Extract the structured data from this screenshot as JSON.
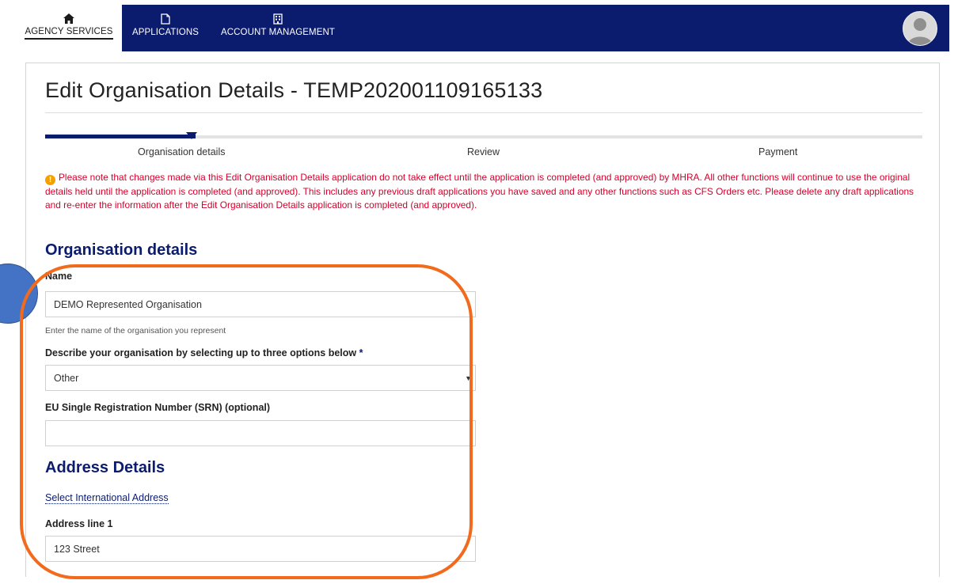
{
  "nav": {
    "items": [
      {
        "label": "AGENCY SERVICES",
        "icon": "home-icon",
        "active": true
      },
      {
        "label": "APPLICATIONS",
        "icon": "document-icon",
        "active": false
      },
      {
        "label": "ACCOUNT MANAGEMENT",
        "icon": "building-icon",
        "active": false
      }
    ],
    "avatar_icon": "user-avatar-icon"
  },
  "page": {
    "title": "Edit Organisation Details - TEMP202001109165133"
  },
  "steps": [
    "Organisation details",
    "Review",
    "Payment"
  ],
  "notice": {
    "icon": "warning-icon",
    "text": "Please note that changes made via this Edit Organisation Details application do not take effect until the application is completed (and approved) by MHRA. All other functions will continue to use the original details held until the application is completed (and approved). This includes any previous draft applications you have saved and any other functions such as CFS Orders etc. Please delete any draft applications and re-enter the information after the Edit Organisation Details application is completed (and approved)."
  },
  "form": {
    "section_title": "Organisation details",
    "name_label": "Name",
    "name_value": "DEMO Represented Organisation",
    "name_hint": "Enter the name of the organisation you represent",
    "describe_label": "Describe your organisation by selecting up to three options below",
    "required_marker": "*",
    "describe_value": "Other",
    "srn_label": "EU Single Registration Number (SRN) (optional)",
    "srn_value": "",
    "address_title": "Address Details",
    "select_address_link": "Select International Address",
    "address1_label": "Address line 1",
    "address1_value": "123 Street"
  },
  "colors": {
    "nav_bg": "#0b1b6e",
    "heading": "#0b1b6e",
    "notice_text": "#d4002a",
    "warning_icon": "#f2a100",
    "annotation_outline": "#f26b1d",
    "annotation_circle": "#4472c4"
  }
}
